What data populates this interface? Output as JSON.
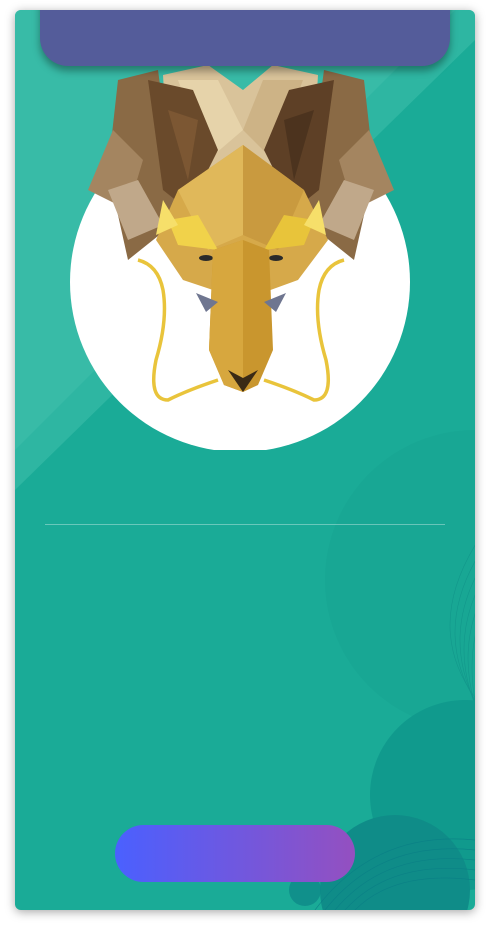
{
  "screen": {
    "title": "",
    "hero_image": "low-poly-golden-dragon-head",
    "action_button_label": ""
  },
  "colors": {
    "card_background": "#1aab97",
    "top_tab": "#545c9a",
    "button_gradient_start": "#4a60ff",
    "button_gradient_end": "#9450c0",
    "hero_circle": "#ffffff"
  }
}
